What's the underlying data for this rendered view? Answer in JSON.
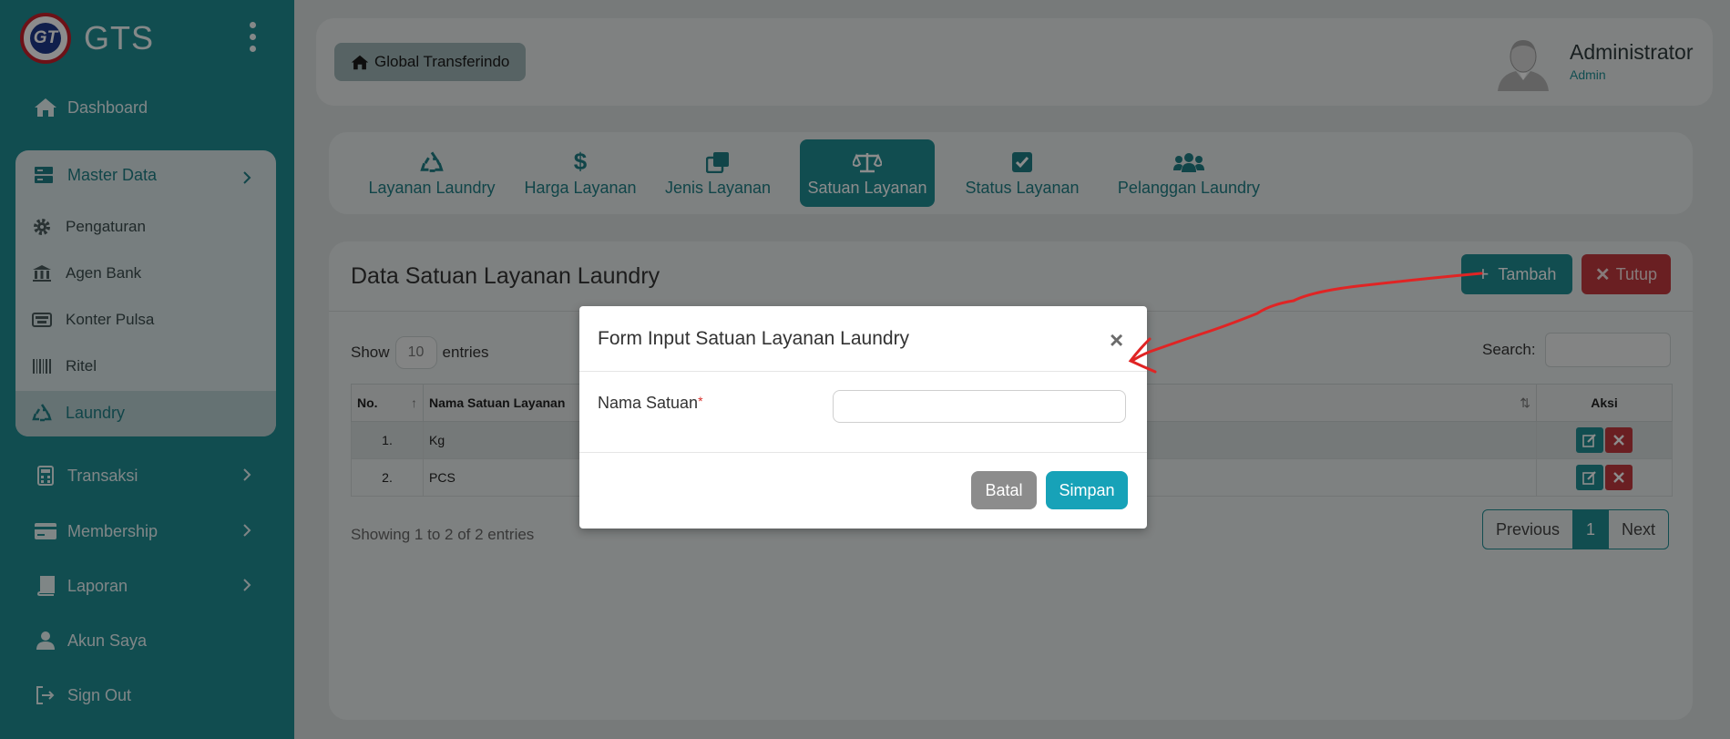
{
  "brand": {
    "name": "GTS",
    "logo_text": "GT"
  },
  "sidebar": {
    "items": [
      {
        "label": "Dashboard",
        "icon": "home-icon"
      },
      {
        "label": "Master Data",
        "icon": "server-icon"
      },
      {
        "label": "Transaksi",
        "icon": "calculator-icon"
      },
      {
        "label": "Membership",
        "icon": "credit-card-icon"
      },
      {
        "label": "Laporan",
        "icon": "book-icon"
      },
      {
        "label": "Akun Saya",
        "icon": "user-icon"
      },
      {
        "label": "Sign Out",
        "icon": "sign-out-icon"
      }
    ],
    "submenu": [
      {
        "label": "Pengaturan",
        "icon": "gear-icon"
      },
      {
        "label": "Agen Bank",
        "icon": "bank-icon"
      },
      {
        "label": "Konter Pulsa",
        "icon": "keyboard-icon"
      },
      {
        "label": "Ritel",
        "icon": "barcode-icon"
      },
      {
        "label": "Laundry",
        "icon": "recycle-icon"
      }
    ]
  },
  "header": {
    "home_label": "Global Transferindo",
    "user_name": "Administrator",
    "user_role": "Admin"
  },
  "tabs": [
    {
      "label": "Layanan Laundry",
      "icon": "recycle-icon"
    },
    {
      "label": "Harga Layanan",
      "icon": "dollar-icon"
    },
    {
      "label": "Jenis Layanan",
      "icon": "clone-icon"
    },
    {
      "label": "Satuan Layanan",
      "icon": "balance-scale-icon",
      "active": true
    },
    {
      "label": "Status Layanan",
      "icon": "check-square-icon"
    },
    {
      "label": "Pelanggan Laundry",
      "icon": "users-icon"
    }
  ],
  "card": {
    "title": "Data Satuan Layanan Laundry",
    "add_label": "Tambah",
    "close_label": "Tutup"
  },
  "table": {
    "show_label": "Show",
    "entries_label": "entries",
    "length_value": "10",
    "search_label": "Search:",
    "columns": [
      "No.",
      "Nama Satuan Layanan",
      "Aksi"
    ],
    "rows": [
      {
        "no": "1.",
        "name": "Kg"
      },
      {
        "no": "2.",
        "name": "PCS"
      }
    ],
    "info": "Showing 1 to 2 of 2 entries",
    "pager": {
      "previous": "Previous",
      "current": "1",
      "next": "Next"
    }
  },
  "modal": {
    "title": "Form Input Satuan Layanan Laundry",
    "close": "×",
    "field_label": "Nama Satuan",
    "required_mark": "*",
    "field_value": "",
    "cancel_label": "Batal",
    "save_label": "Simpan"
  },
  "colors": {
    "primary": "#1f8c93",
    "danger": "#c13a3e",
    "info": "#17a2b8",
    "annotation": "#e02424"
  }
}
